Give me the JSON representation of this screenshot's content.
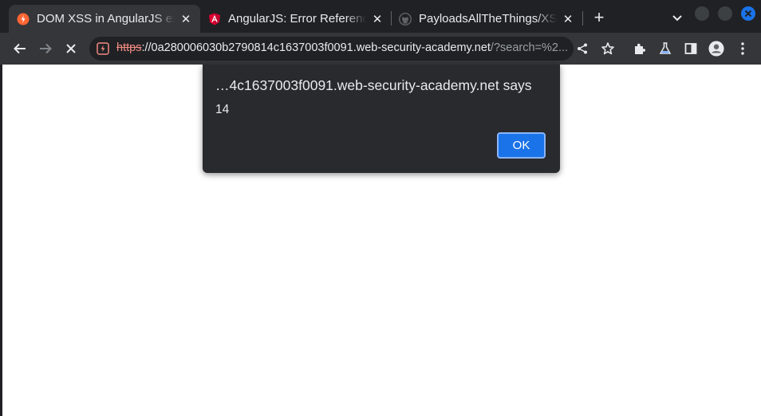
{
  "tabs": [
    {
      "title": "DOM XSS in AngularJS exp",
      "close_label": "✕"
    },
    {
      "title": "AngularJS: Error Referenc",
      "close_label": "✕"
    },
    {
      "title": "PayloadsAllTheThings/XS",
      "close_label": "✕"
    }
  ],
  "newtab_label": "+",
  "address": {
    "scheme": "https",
    "host": "://0a280006030b2790814c1637003f0091.web-security-academy.net",
    "path": "/?search=%2..."
  },
  "dialog": {
    "title": "…4c1637003f0091.web-security-academy.net says",
    "message": "14",
    "ok_label": "OK"
  },
  "colors": {
    "accent": "#1a73e8",
    "window_close": "#1a73e8",
    "insecure_scheme": "#f28b82"
  }
}
